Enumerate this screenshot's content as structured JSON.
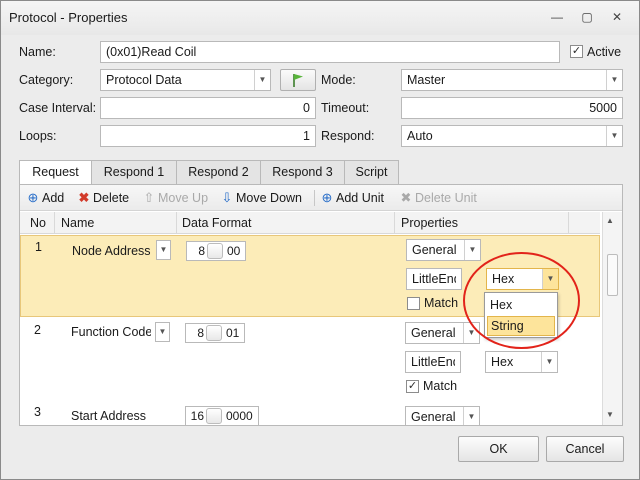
{
  "window": {
    "title": "Protocol - Properties"
  },
  "form": {
    "name_label": "Name:",
    "name_value": "(0x01)Read Coil",
    "active_label": "Active",
    "active_checked": true,
    "category_label": "Category:",
    "category_value": "Protocol Data",
    "mode_label": "Mode:",
    "mode_value": "Master",
    "case_interval_label": "Case Interval:",
    "case_interval_value": "0",
    "timeout_label": "Timeout:",
    "timeout_value": "5000",
    "loops_label": "Loops:",
    "loops_value": "1",
    "respond_label": "Respond:",
    "respond_value": "Auto"
  },
  "tabs": [
    "Request",
    "Respond 1",
    "Respond 2",
    "Respond 3",
    "Script"
  ],
  "toolbar": {
    "add": "Add",
    "delete": "Delete",
    "move_up": "Move Up",
    "move_down": "Move Down",
    "add_unit": "Add Unit",
    "delete_unit": "Delete Unit"
  },
  "grid": {
    "headers": {
      "no": "No",
      "name": "Name",
      "data_format": "Data Format",
      "properties": "Properties"
    },
    "rows": [
      {
        "no": "1",
        "name": "Node Address",
        "size": "8",
        "value": "00",
        "prop_general": "General",
        "prop_endian": "LittleEndian",
        "prop_type": "Hex",
        "match_label": "Match",
        "match_checked": false
      },
      {
        "no": "2",
        "name": "Function Code",
        "size": "8",
        "value": "01",
        "prop_general": "General",
        "prop_endian": "LittleEndian",
        "prop_type": "Hex",
        "match_label": "Match",
        "match_checked": true
      },
      {
        "no": "3",
        "name": "Start Address",
        "size": "16",
        "value": "0000",
        "prop_general": "General"
      }
    ]
  },
  "dropdown": {
    "options": [
      "Hex",
      "String"
    ],
    "highlighted": "String"
  },
  "buttons": {
    "ok": "OK",
    "cancel": "Cancel"
  },
  "colors": {
    "selected_row": "#fcecb8",
    "highlight": "#fde49b",
    "annotation_circle": "#e2231a"
  }
}
